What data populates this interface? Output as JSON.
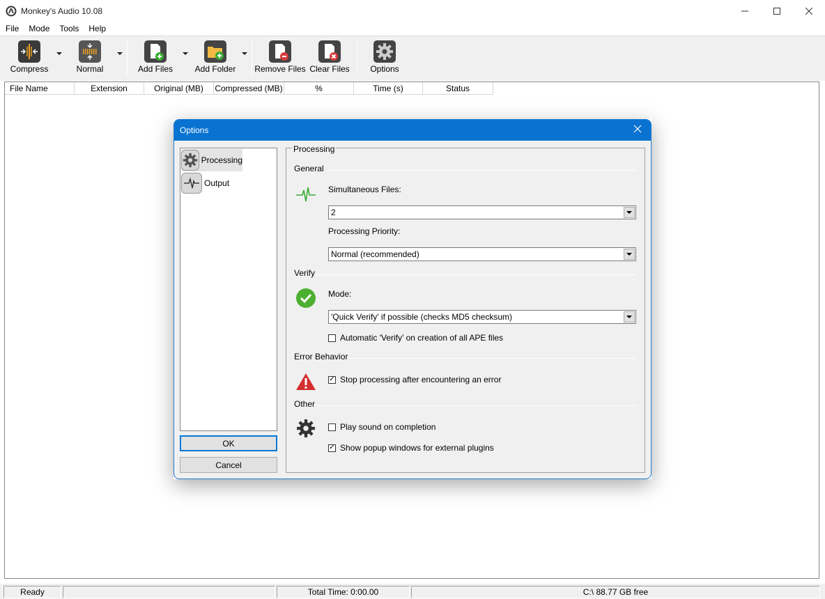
{
  "window": {
    "title": "Monkey's Audio 10.08"
  },
  "menu": {
    "file": "File",
    "mode": "Mode",
    "tools": "Tools",
    "help": "Help"
  },
  "toolbar": {
    "compress": "Compress",
    "normal": "Normal",
    "add_files": "Add Files",
    "add_folder": "Add Folder",
    "remove_files": "Remove Files",
    "clear_files": "Clear Files",
    "options": "Options"
  },
  "columns": [
    "File Name",
    "Extension",
    "Original (MB)",
    "Compressed (MB)",
    "%",
    "Time (s)",
    "Status"
  ],
  "statusbar": {
    "ready": "Ready",
    "total_time": "Total Time: 0:00.00",
    "disk": "C:\\ 88.77 GB free"
  },
  "dialog": {
    "title": "Options",
    "nav": {
      "processing": "Processing",
      "output": "Output"
    },
    "ok": "OK",
    "cancel": "Cancel",
    "panel_title": "Processing",
    "general": {
      "title": "General",
      "simultaneous_label": "Simultaneous Files:",
      "simultaneous_value": "2",
      "priority_label": "Processing Priority:",
      "priority_value": "Normal (recommended)"
    },
    "verify": {
      "title": "Verify",
      "mode_label": "Mode:",
      "mode_value": "'Quick Verify' if possible (checks MD5 checksum)",
      "auto_verify": "Automatic 'Verify' on creation of all APE files",
      "auto_verify_checked": false
    },
    "error": {
      "title": "Error Behavior",
      "stop_processing": "Stop processing after encountering an error",
      "stop_processing_checked": true
    },
    "other": {
      "title": "Other",
      "play_sound": "Play sound on completion",
      "play_sound_checked": false,
      "show_popup": "Show popup windows for external plugins",
      "show_popup_checked": true
    }
  },
  "colors": {
    "dialog_titlebar": "#0a73d1",
    "accent": "#0078d7"
  }
}
